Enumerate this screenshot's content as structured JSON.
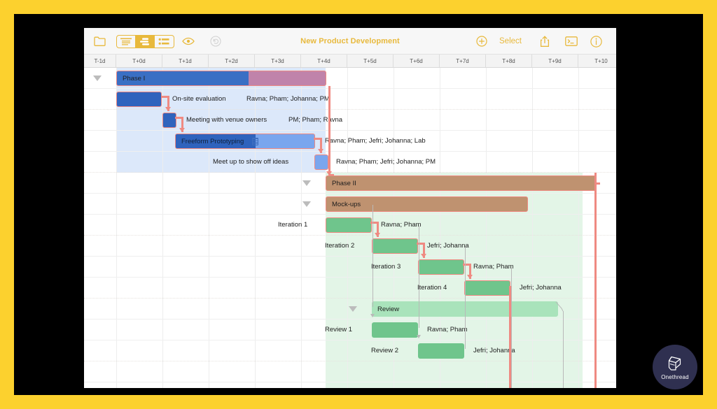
{
  "app": {
    "title": "New Product Development",
    "theme_accent": "#E8B93C",
    "frame_color": "#FCD12E"
  },
  "toolbar": {
    "folder_icon": "folder-icon",
    "view_modes": [
      {
        "name": "outline-view",
        "selected": false
      },
      {
        "name": "gantt-view",
        "selected": true
      },
      {
        "name": "grid-view",
        "selected": false
      }
    ],
    "eye_icon": "eye-icon",
    "undo_icon": "undo-icon",
    "add_icon": "plus-circle-icon",
    "select_label": "Select",
    "share_icon": "share-icon",
    "export_icon": "export-icon",
    "info_icon": "info-circle-icon"
  },
  "timeline": {
    "ticks": [
      "T-1d",
      "T+0d",
      "T+1d",
      "T+2d",
      "T+3d",
      "T+4d",
      "T+5d",
      "T+6d",
      "T+7d",
      "T+8d",
      "T+9d",
      "T+10"
    ]
  },
  "colors": {
    "phase1_bar": "#3a6fc4",
    "phase1_remaining": "#c083aa",
    "phase1_region": "#dce8fa",
    "task_blue": "#2f63bd",
    "task_light_blue": "#7aa6ee",
    "phase2_bar": "#bf9270",
    "phase2_region": "#e3f5e7",
    "task_green": "#6fc58c",
    "group_green": "#a9e3bb",
    "dependency": "#ef8a82"
  },
  "rows": [
    {
      "id": "phase-1",
      "label": "Phase I",
      "label_in_bar": true,
      "has_disclosure": true,
      "type": "summary",
      "resources": ""
    },
    {
      "id": "on-site-evaluation",
      "label": "On-site evaluation",
      "label_in_bar": false,
      "has_disclosure": false,
      "type": "task",
      "resources": "Ravna; Pham; Johanna; PM"
    },
    {
      "id": "meeting-with-venue-owners",
      "label": "Meeting with venue owners",
      "label_in_bar": false,
      "has_disclosure": false,
      "type": "task",
      "resources": "PM; Pham; Ravna"
    },
    {
      "id": "freeform-prototyping",
      "label": "Freeform Prototyping",
      "label_in_bar": true,
      "has_disclosure": false,
      "type": "task",
      "has_note_icon": true,
      "resources": "Ravna; Pham; Jefri; Johanna; Lab"
    },
    {
      "id": "meet-up-to-show-off-ideas",
      "label": "Meet up to show off ideas",
      "label_in_bar": false,
      "has_disclosure": false,
      "type": "task",
      "resources": "Ravna; Pham; Jefri; Johanna; PM"
    },
    {
      "id": "phase-2",
      "label": "Phase II",
      "label_in_bar": true,
      "has_disclosure": true,
      "type": "summary",
      "resources": ""
    },
    {
      "id": "mock-ups",
      "label": "Mock-ups",
      "label_in_bar": true,
      "has_disclosure": true,
      "type": "summary",
      "resources": ""
    },
    {
      "id": "iteration-1",
      "label": "Iteration 1",
      "label_in_bar": false,
      "has_disclosure": false,
      "type": "task",
      "resources": "Ravna; Pham"
    },
    {
      "id": "iteration-2",
      "label": "Iteration 2",
      "label_in_bar": false,
      "has_disclosure": false,
      "type": "task",
      "resources": "Jefri; Johanna"
    },
    {
      "id": "iteration-3",
      "label": "Iteration 3",
      "label_in_bar": false,
      "has_disclosure": false,
      "type": "task",
      "resources": "Ravna; Pham"
    },
    {
      "id": "iteration-4",
      "label": "Iteration 4",
      "label_in_bar": false,
      "has_disclosure": false,
      "type": "task",
      "resources": "Jefri; Johanna"
    },
    {
      "id": "review",
      "label": "Review",
      "label_in_bar": true,
      "has_disclosure": true,
      "type": "summary",
      "resources": ""
    },
    {
      "id": "review-1",
      "label": "Review 1",
      "label_in_bar": false,
      "has_disclosure": false,
      "type": "task",
      "resources": "Ravna; Pham"
    },
    {
      "id": "review-2",
      "label": "Review 2",
      "label_in_bar": false,
      "has_disclosure": false,
      "type": "task",
      "resources": "Jefri; Johanna"
    }
  ],
  "watermark": {
    "brand": "Onethread"
  }
}
